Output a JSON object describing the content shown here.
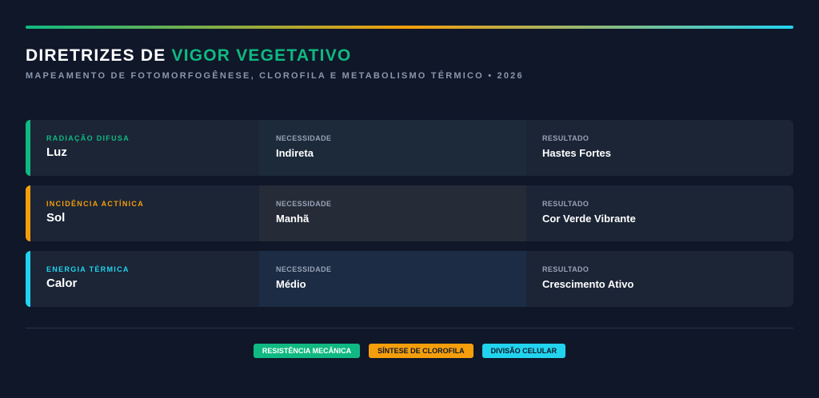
{
  "header": {
    "title_prefix": "DIRETRIZES DE ",
    "title_accent": "VIGOR VEGETATIVO",
    "subtitle": "MAPEAMENTO DE FOTOMORFOGÊNESE, CLOROFILA E METABOLISMO TÉRMICO • 2026"
  },
  "colors": {
    "background": "#0f1729",
    "green": "#10b981",
    "orange": "#f59e0b",
    "cyan": "#22d3ee"
  },
  "rows": [
    {
      "category": "RADIAÇÃO DIFUSA",
      "factor": "Luz",
      "need_label": "NECESSIDADE",
      "need": "Indireta",
      "result_label": "RESULTADO",
      "result": "Hastes Fortes",
      "accent": "#10b981",
      "need_bg": "#1c2a3a"
    },
    {
      "category": "INCIDÊNCIA ACTÍNICA",
      "factor": "Sol",
      "need_label": "NECESSIDADE",
      "need": "Manhã",
      "result_label": "RESULTADO",
      "result": "Cor Verde Vibrante",
      "accent": "#f59e0b",
      "need_bg": "#252c38"
    },
    {
      "category": "ENERGIA TÉRMICA",
      "factor": "Calor",
      "need_label": "NECESSIDADE",
      "need": "Médio",
      "result_label": "RESULTADO",
      "result": "Crescimento Ativo",
      "accent": "#22d3ee",
      "need_bg": "#1c2c44"
    }
  ],
  "legend": [
    {
      "label": "RESISTÊNCIA MECÂNICA",
      "color": "#10b981"
    },
    {
      "label": "SÍNTESE DE CLOROFILA",
      "color": "#f59e0b"
    },
    {
      "label": "DIVISÃO CELULAR",
      "color": "#22d3ee"
    }
  ]
}
